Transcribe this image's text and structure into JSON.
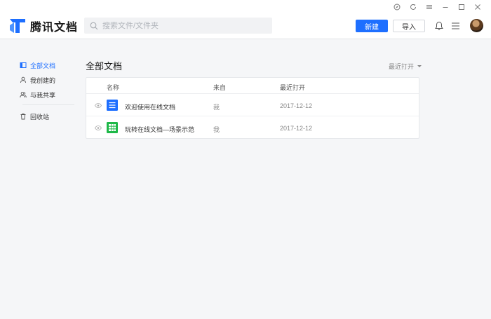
{
  "app": {
    "name": "腾讯文档"
  },
  "search": {
    "placeholder": "搜索文件/文件夹"
  },
  "toolbar": {
    "new_label": "新建",
    "import_label": "导入"
  },
  "sidebar": {
    "items": [
      {
        "label": "全部文档",
        "icon": "docs-icon",
        "active": true
      },
      {
        "label": "我创建的",
        "icon": "person-icon",
        "active": false
      },
      {
        "label": "与我共享",
        "icon": "people-icon",
        "active": false
      },
      {
        "label": "回收站",
        "icon": "trash-icon",
        "active": false
      }
    ]
  },
  "main": {
    "title": "全部文档",
    "sort_label": "最近打开",
    "columns": [
      "名称",
      "来自",
      "最近打开"
    ],
    "rows": [
      {
        "name": "欢迎使用在线文档",
        "from": "我",
        "opened": "2017-12-12",
        "type": "doc",
        "color": "#1e6fff"
      },
      {
        "name": "玩转在线文档—场景示范",
        "from": "我",
        "opened": "2017-12-12",
        "type": "sheet",
        "color": "#1eb848"
      }
    ]
  },
  "colors": {
    "accent": "#1e6fff",
    "sheet": "#1eb848"
  }
}
